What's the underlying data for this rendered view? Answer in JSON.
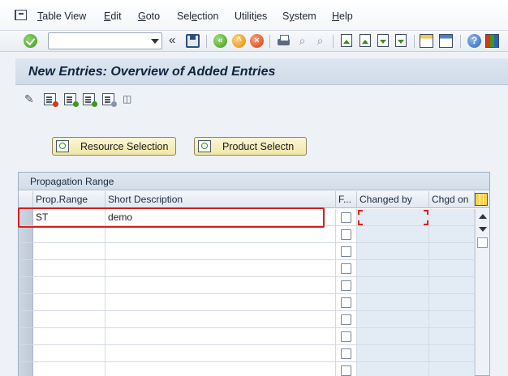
{
  "menu": {
    "items": [
      {
        "pre": "",
        "ul": "T",
        "post": "able View"
      },
      {
        "pre": "",
        "ul": "E",
        "post": "dit"
      },
      {
        "pre": "",
        "ul": "G",
        "post": "oto"
      },
      {
        "pre": "Sel",
        "ul": "e",
        "post": "ction"
      },
      {
        "pre": "Utilit",
        "ul": "i",
        "post": "es"
      },
      {
        "pre": "S",
        "ul": "y",
        "post": "stem"
      },
      {
        "pre": "",
        "ul": "H",
        "post": "elp"
      }
    ]
  },
  "toolbar": {
    "command_value": "",
    "more_glyph": "«",
    "icons": [
      "check-icon",
      "save-icon",
      "back-icon",
      "exit-icon",
      "cancel-icon",
      "print-icon",
      "find-icon",
      "find-next-icon",
      "first-page-icon",
      "previous-page-icon",
      "next-page-icon",
      "last-page-icon",
      "new-session-icon",
      "shortcut-icon",
      "help-icon",
      "layout-icon"
    ]
  },
  "title": "New Entries: Overview of Added Entries",
  "buttons": {
    "resource_selection": "Resource Selection",
    "product_selection": "Product Selectn"
  },
  "table": {
    "caption": "Propagation Range",
    "columns": [
      "Prop.Range",
      "Short Description",
      "F...",
      "Changed by",
      "Chgd on"
    ],
    "rows": [
      {
        "range": "ST",
        "desc": "demo",
        "flag": false,
        "changed_by": "",
        "changed_on": ""
      },
      {
        "range": "",
        "desc": "",
        "flag": false,
        "changed_by": "",
        "changed_on": ""
      },
      {
        "range": "",
        "desc": "",
        "flag": false,
        "changed_by": "",
        "changed_on": ""
      },
      {
        "range": "",
        "desc": "",
        "flag": false,
        "changed_by": "",
        "changed_on": ""
      },
      {
        "range": "",
        "desc": "",
        "flag": false,
        "changed_by": "",
        "changed_on": ""
      },
      {
        "range": "",
        "desc": "",
        "flag": false,
        "changed_by": "",
        "changed_on": ""
      },
      {
        "range": "",
        "desc": "",
        "flag": false,
        "changed_by": "",
        "changed_on": ""
      },
      {
        "range": "",
        "desc": "",
        "flag": false,
        "changed_by": "",
        "changed_on": ""
      },
      {
        "range": "",
        "desc": "",
        "flag": false,
        "changed_by": "",
        "changed_on": ""
      },
      {
        "range": "",
        "desc": "",
        "flag": false,
        "changed_by": "",
        "changed_on": ""
      }
    ]
  },
  "colors": {
    "highlight": "#d21f1f",
    "button_bg": "#efe6a6",
    "title_bar": "#d5e0ec"
  }
}
